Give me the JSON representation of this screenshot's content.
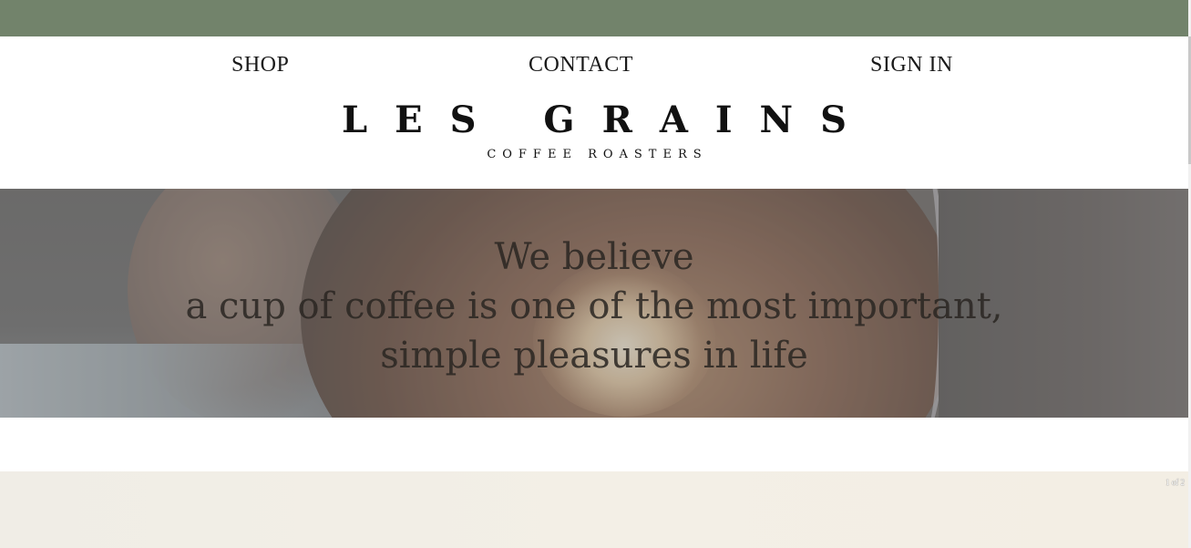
{
  "colors": {
    "top_bar": "#72836b",
    "bottom_section": "#f3efe6"
  },
  "nav": {
    "shop": "SHOP",
    "contact": "CONTACT",
    "sign_in": "SIGN IN"
  },
  "logo": {
    "title": "LES GRAINS",
    "subtitle": "COFFEE ROASTERS"
  },
  "hero": {
    "line1": "We believe",
    "line2": "a cup of coffee is one of the most important,",
    "line3": "simple pleasures in life"
  },
  "slideshow": {
    "counter": "1 of 2"
  }
}
